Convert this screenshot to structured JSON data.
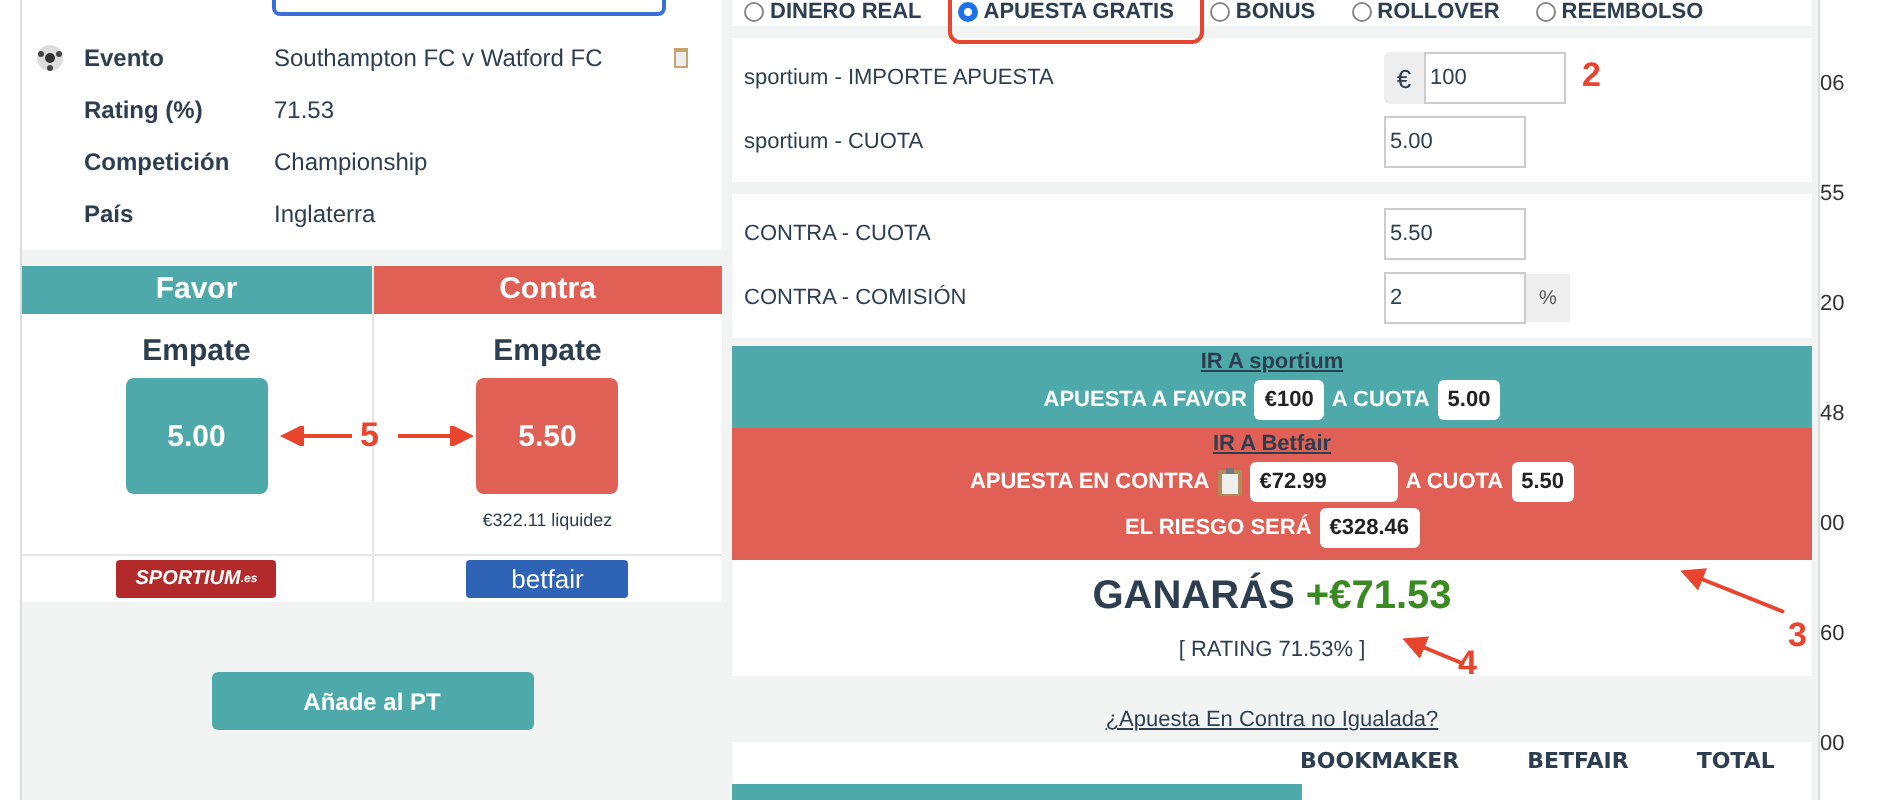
{
  "radio_options": [
    {
      "label": "DINERO REAL",
      "selected": false
    },
    {
      "label": "APUESTA GRATIS",
      "selected": true
    },
    {
      "label": "BONUS",
      "selected": false
    },
    {
      "label": "ROLLOVER",
      "selected": false
    },
    {
      "label": "REEMBOLSO",
      "selected": false
    }
  ],
  "event_info": [
    {
      "label": "Evento",
      "value": "Southampton FC v Watford FC",
      "kind": "event"
    },
    {
      "label": "Rating (%)",
      "value": "71.53",
      "kind": "plain"
    },
    {
      "label": "Competición",
      "value": "Championship",
      "kind": "plain"
    },
    {
      "label": "País",
      "value": "Inglaterra",
      "kind": "plain"
    }
  ],
  "odds_columns": [
    {
      "kind": "favor",
      "header": "Favor",
      "selection": "Empate",
      "odds": "5.00",
      "logo": "SPORTIUM",
      "logo_suffix": ".es"
    },
    {
      "kind": "contra",
      "header": "Contra",
      "selection": "Empate",
      "odds": "5.50",
      "liquidity": "€322.11 liquidez",
      "logo": "betfair"
    }
  ],
  "add_button": "Añade al PT",
  "form_sections": [
    [
      {
        "label": "sportium - IMPORTE APUESTA",
        "value": "100",
        "prefix": "€"
      },
      {
        "label": "sportium - CUOTA",
        "value": "5.00"
      }
    ],
    [
      {
        "label": "CONTRA - CUOTA",
        "value": "5.50"
      },
      {
        "label": "CONTRA - COMISIÓN",
        "value": "2",
        "suffix": "%"
      }
    ]
  ],
  "instructions": [
    {
      "kind": "favor",
      "link": "IR A sportium",
      "lines": [
        [
          {
            "kind": "text",
            "text": "APUESTA A FAVOR"
          },
          {
            "kind": "value",
            "text": "€100"
          },
          {
            "kind": "text",
            "text": "A CUOTA"
          },
          {
            "kind": "value",
            "text": "5.00"
          }
        ]
      ]
    },
    {
      "kind": "contra",
      "link": "IR A Betfair",
      "lines": [
        [
          {
            "kind": "text",
            "text": "APUESTA EN CONTRA"
          },
          {
            "kind": "icon"
          },
          {
            "kind": "wide",
            "text": "€72.99"
          },
          {
            "kind": "text",
            "text": "A CUOTA"
          },
          {
            "kind": "value",
            "text": "5.50"
          }
        ],
        [
          {
            "kind": "text",
            "text": "EL RIESGO SERÁ"
          },
          {
            "kind": "value",
            "text": "€328.46"
          }
        ]
      ]
    }
  ],
  "result": {
    "label": "GANARÁS",
    "amount": "+€71.53",
    "rating": "[ RATING 71.53% ]"
  },
  "unmatched_link": "¿Apuesta En Contra no Igualada?",
  "summary_columns": [
    "BOOKMAKER",
    "BETFAIR",
    "TOTAL"
  ],
  "annotations": [
    {
      "label": "2"
    },
    {
      "label": "3"
    },
    {
      "label": "4"
    },
    {
      "label": "5"
    }
  ],
  "background_fragments": [
    "06",
    "55",
    "20",
    "48",
    "00",
    "60",
    "00"
  ]
}
